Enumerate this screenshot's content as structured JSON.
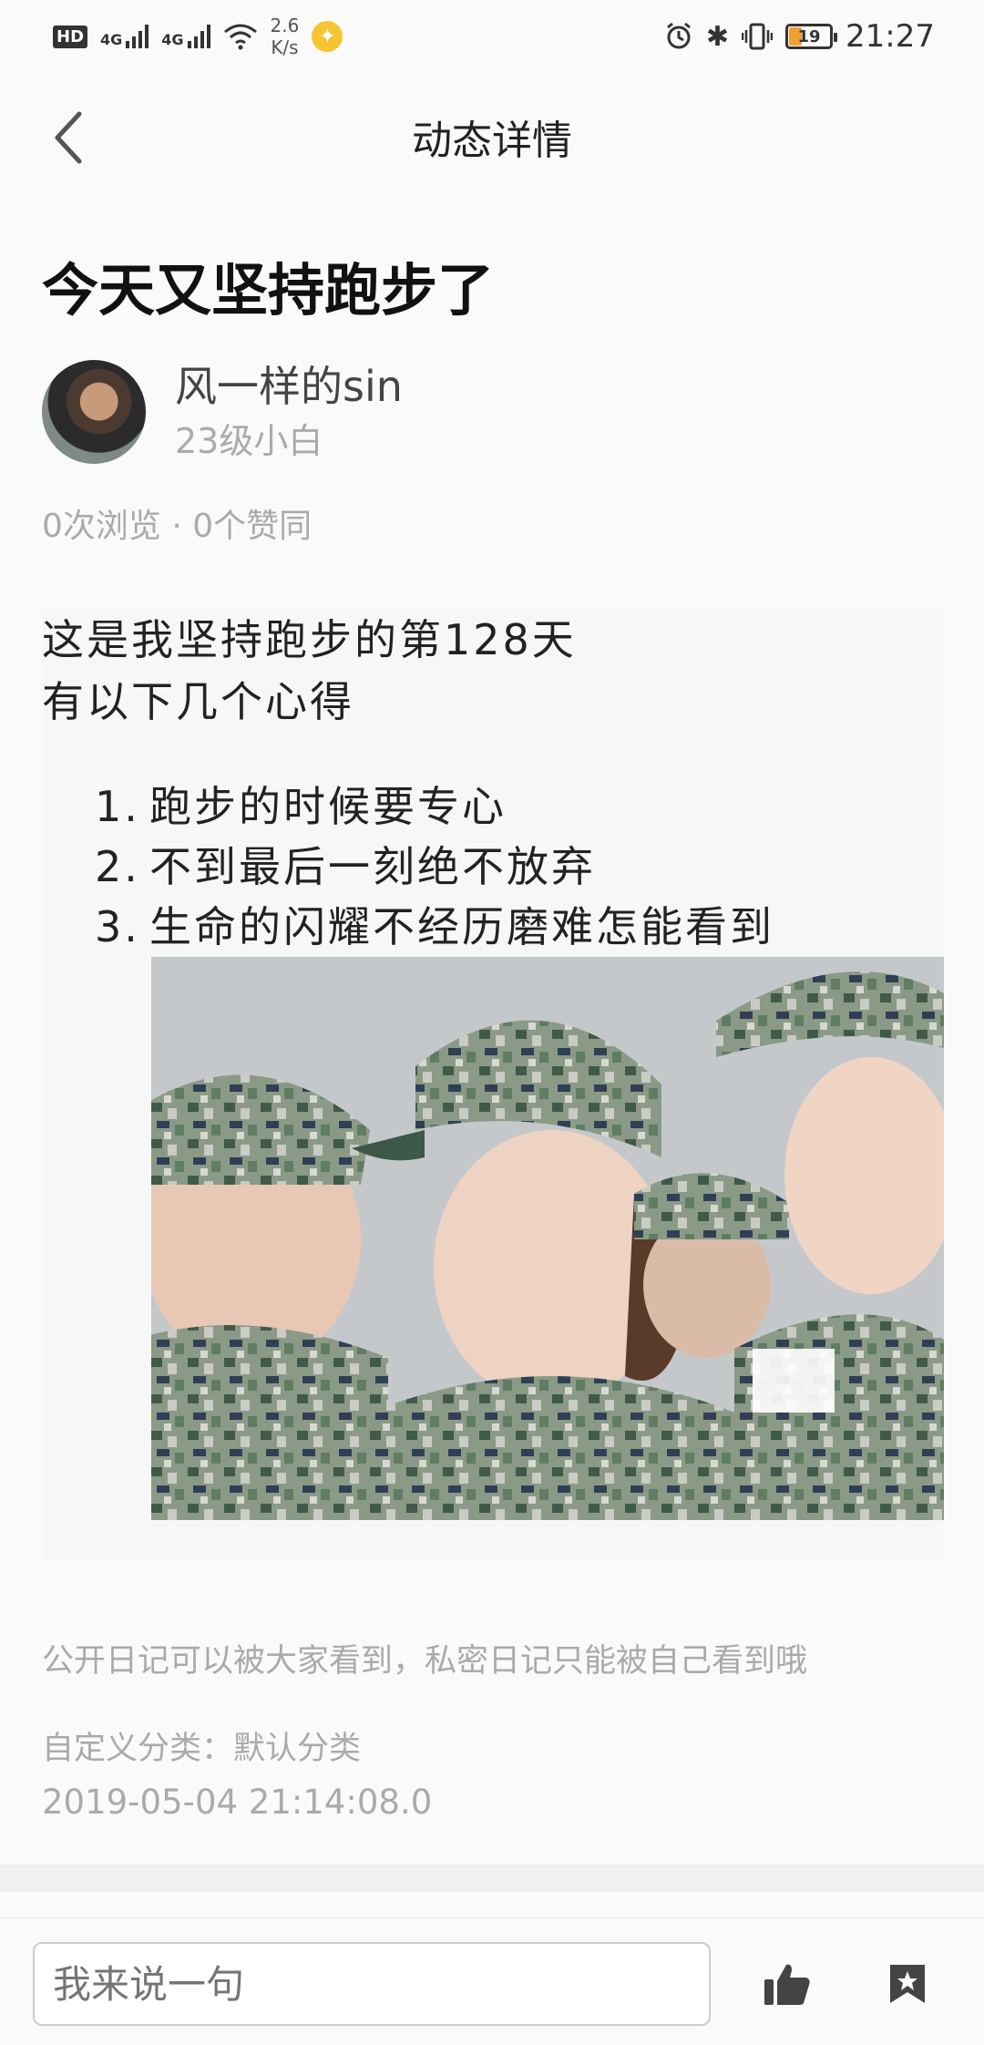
{
  "status_bar": {
    "hd": "HD",
    "net1": "4G",
    "net2": "4G",
    "speed_value": "2.6",
    "speed_unit": "K/s",
    "battery": "19",
    "time": "21:27"
  },
  "nav": {
    "title": "动态详情"
  },
  "post": {
    "title": "今天又坚持跑步了",
    "author_name": "风一样的sin",
    "author_level": "23级小白",
    "stats": "0次浏览 · 0个赞同",
    "body_lines": [
      "这是我坚持跑步的第128天",
      "有以下几个心得"
    ],
    "list": [
      {
        "num": "1.",
        "text": "跑步的时候要专心"
      },
      {
        "num": "2.",
        "text": "不到最后一刻绝不放弃"
      },
      {
        "num": "3.",
        "text": "生命的闪耀不经历磨难怎能看到"
      }
    ],
    "note": "公开日记可以被大家看到，私密日记只能被自己看到哦",
    "category": "自定义分类：默认分类",
    "datetime": "2019-05-04 21:14:08.0"
  },
  "bottom_bar": {
    "comment_placeholder": "我来说一句"
  },
  "colors": {
    "accent_yellow": "#f5c531",
    "muted_text": "#aaaaaa",
    "camo_green": "#5b7a5f"
  }
}
